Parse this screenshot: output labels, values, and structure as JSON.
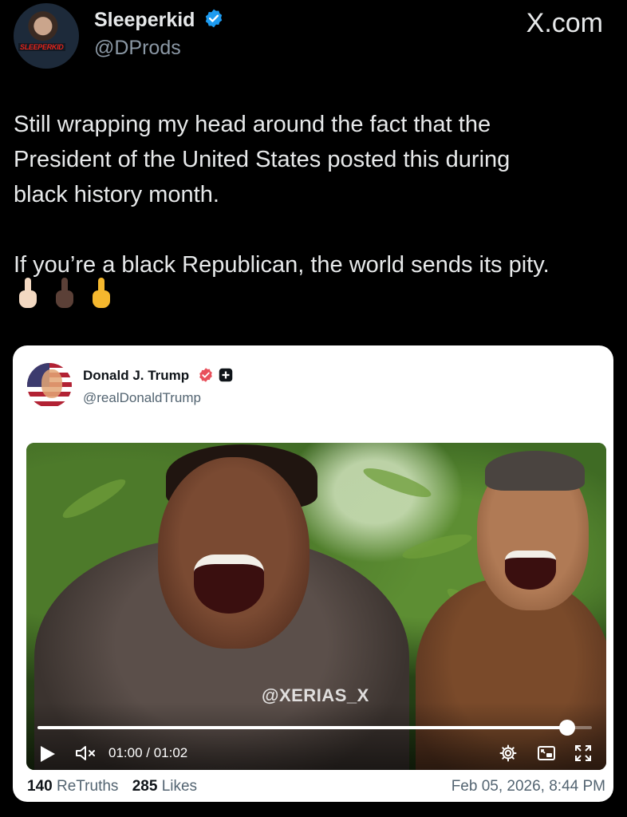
{
  "post": {
    "author_name": "Sleeperkid",
    "author_handle": "@DProds",
    "avatar_text": "SLEEPERKID",
    "source": "X.com",
    "text_lines": [
      "Still wrapping my head around the fact that the",
      "President of the United States posted this during",
      "black history month.",
      "If you’re a black Republican, the world sends its pity."
    ],
    "emoji": [
      "middle-finger-light",
      "middle-finger-dark",
      "middle-finger-yellow"
    ]
  },
  "embedded_post": {
    "author_name": "Donald J. Trump",
    "author_handle": "@realDonaldTrump",
    "video": {
      "watermark": "@XERIAS_X",
      "current_time": "01:00",
      "duration": "01:02",
      "time_display": "01:00 / 01:02",
      "progress_fraction": 0.955
    },
    "retruths_count": "140",
    "retruths_label": "ReTruths",
    "likes_count": "285",
    "likes_label": "Likes",
    "date": "Feb 05, 2026, 8:44 PM"
  },
  "colors": {
    "background": "#000000",
    "verified_blue": "#1d9bf0",
    "truth_badge_red": "#e8505b",
    "card_bg": "#ffffff"
  },
  "icons": {
    "verified": "verified-badge-icon",
    "play": "play-icon",
    "volume_muted": "volume-muted-icon",
    "settings": "gear-icon",
    "pip": "picture-in-picture-icon",
    "fullscreen": "fullscreen-icon"
  }
}
